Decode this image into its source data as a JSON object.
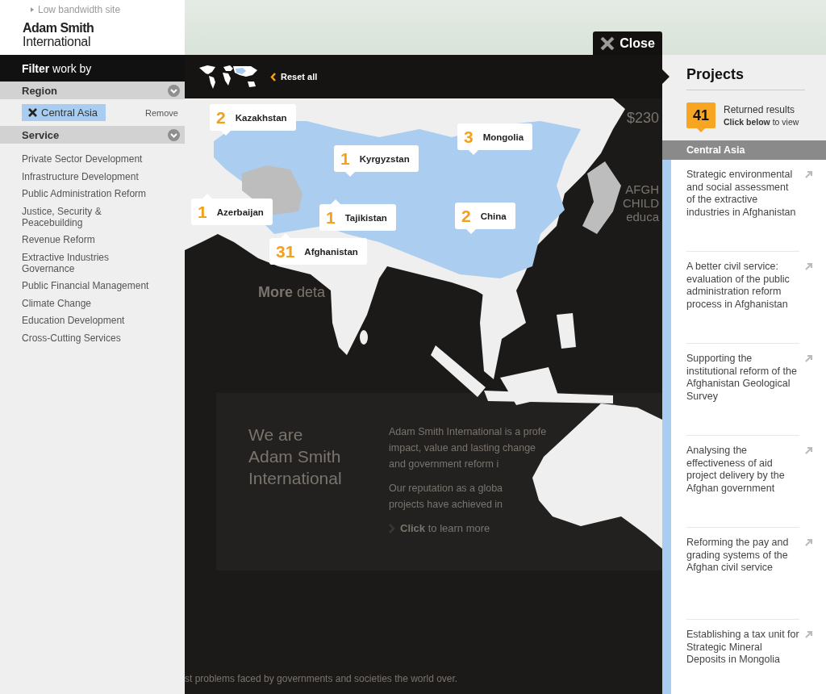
{
  "site": {
    "low_bandwidth_link": "Low bandwidth site",
    "logo_line_1": "Adam Smith",
    "logo_line_2": "International"
  },
  "filter": {
    "title": "**Filter** work by",
    "region": {
      "heading": "Region",
      "active_filters": [
        {
          "label": "Central Asia"
        }
      ],
      "remove_label": "Remove"
    },
    "service": {
      "heading": "Service",
      "items": [
        "Private Sector Development",
        "Infrastructure Development",
        "Public Administration Reform",
        "Justice, Security & Peacebuilding",
        "Revenue Reform",
        "Extractive Industries Governance",
        "Public Financial Management",
        "Climate Change",
        "Education Development",
        "Cross-Cutting Services"
      ]
    }
  },
  "overlay": {
    "close_label": "Close",
    "reset_label": "Reset all",
    "countries": [
      {
        "count": "2",
        "name": "Kazakhstan"
      },
      {
        "count": "3",
        "name": "Mongolia"
      },
      {
        "count": "1",
        "name": "Kyrgyzstan"
      },
      {
        "count": "1",
        "name": "Azerbaijan"
      },
      {
        "count": "1",
        "name": "Tajikistan"
      },
      {
        "count": "2",
        "name": "China"
      },
      {
        "count": "31",
        "name": "Afghanistan"
      }
    ]
  },
  "background_page": {
    "side_texts": [
      "$230",
      "AFGH",
      "CHILD",
      "educa"
    ],
    "more_heading": "**More** deta",
    "intro_heading": [
      "We are",
      "Adam Smith",
      "International"
    ],
    "paragraph_lines": [
      "Adam Smith International is a profe",
      "impact, value and lasting change",
      "and government reform i"
    ],
    "paragraph_2_lines": [
      "Our reputation as a globa",
      "projects have achieved in"
    ],
    "link": "**Click** to learn more",
    "footer_line": "st problems faced by governments and societies the world over."
  },
  "projects": {
    "title": "Projects",
    "count": "41",
    "count_label": "Returned results",
    "count_hint": "**Click below** to view",
    "group": "Central Asia",
    "items": [
      "Strategic environmental and social assessment of the extractive industries in Afghanistan",
      "A better civil service: evaluation of the public administration reform process in Afghanistan",
      "Supporting the institutional reform of the Afghanistan Geological Survey",
      "Analysing the effectiveness of aid project delivery by the Afghan government",
      "Reforming the pay and grading systems of the Afghan civil service",
      "Establishing a tax unit for Strategic Mineral Deposits in Mongolia"
    ]
  }
}
